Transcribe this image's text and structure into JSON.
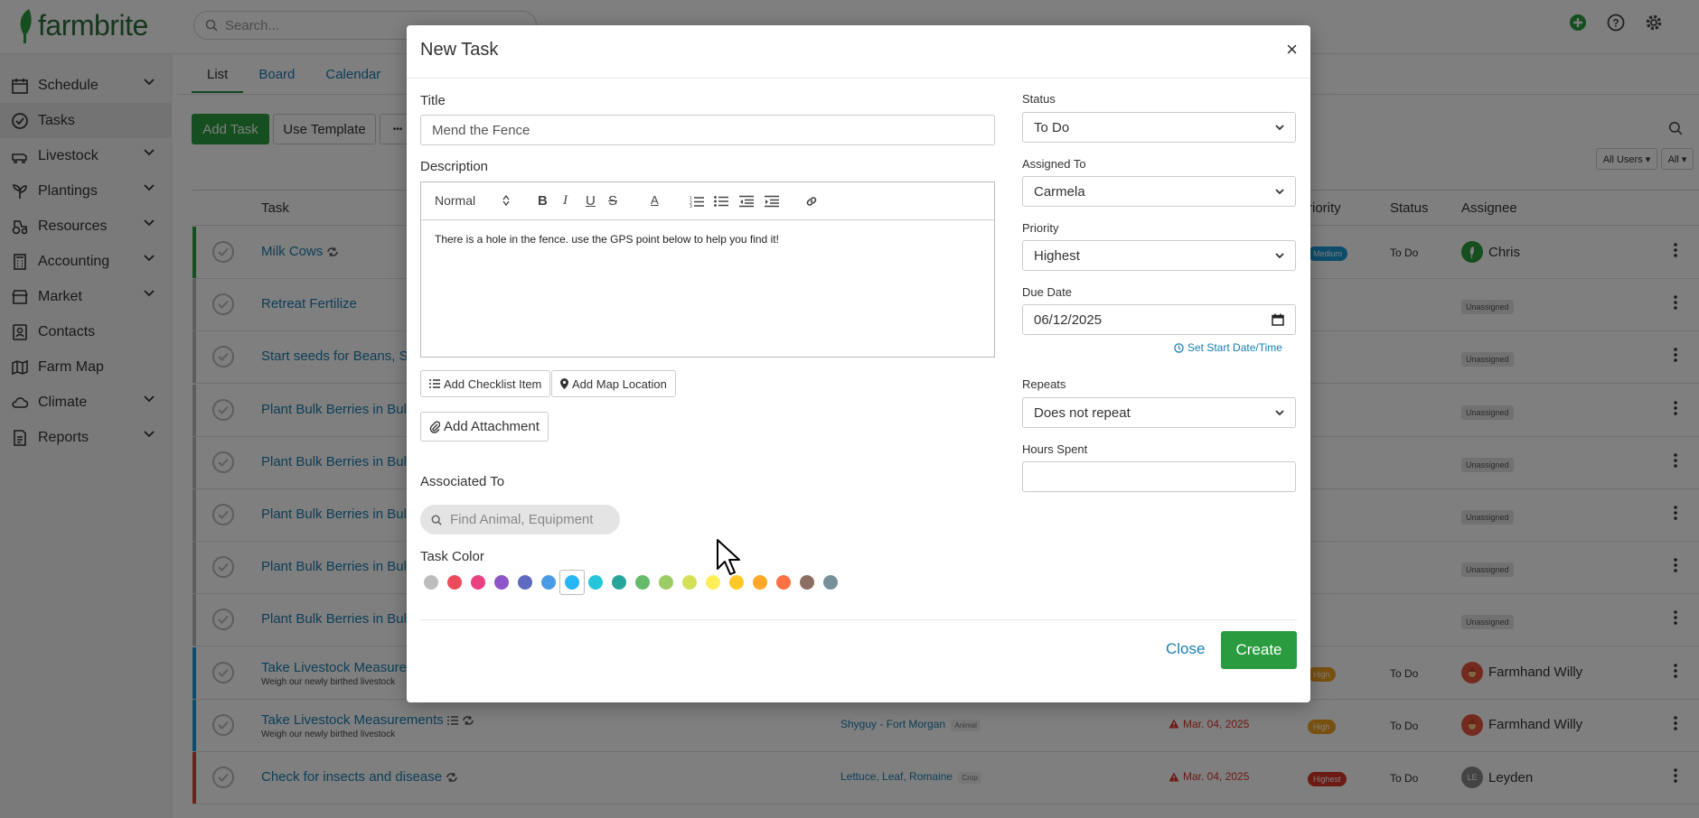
{
  "brand": {
    "name": "farmbrite",
    "green": "#2a9c3f"
  },
  "top": {
    "search_placeholder": "Search..."
  },
  "sidebar": {
    "items": [
      {
        "label": "Schedule",
        "icon": "calendar-icon",
        "chevron": true
      },
      {
        "label": "Tasks",
        "icon": "check-circle-icon",
        "chevron": false
      },
      {
        "label": "Livestock",
        "icon": "cow-icon",
        "chevron": true
      },
      {
        "label": "Plantings",
        "icon": "seedling-icon",
        "chevron": true
      },
      {
        "label": "Resources",
        "icon": "tractor-icon",
        "chevron": true
      },
      {
        "label": "Accounting",
        "icon": "calculator-icon",
        "chevron": true
      },
      {
        "label": "Market",
        "icon": "store-icon",
        "chevron": true
      },
      {
        "label": "Contacts",
        "icon": "contacts-icon",
        "chevron": false
      },
      {
        "label": "Farm Map",
        "icon": "map-icon",
        "chevron": false
      },
      {
        "label": "Climate",
        "icon": "cloud-icon",
        "chevron": true
      },
      {
        "label": "Reports",
        "icon": "report-icon",
        "chevron": true
      }
    ]
  },
  "main": {
    "tabs": [
      "List",
      "Board",
      "Calendar"
    ],
    "add_task": "Add Task",
    "use_template": "Use Template",
    "more": "•••",
    "filter_users": "All Users ▾",
    "filter_all": "All ▾",
    "columns": {
      "task": "Task",
      "priority": "riority",
      "status": "Status",
      "assignee": "Assignee"
    },
    "rows": [
      {
        "name": "Milk Cows",
        "repeat": true,
        "stripe": "#2a9c3f",
        "priority": "Medium",
        "priority_color": "#1a9ad6",
        "status": "To Do",
        "assignee": "Chris",
        "avatar": "farm",
        "sub": "",
        "assoc": "",
        "date": ""
      },
      {
        "name": "Retreat Fertilize",
        "repeat": false,
        "stripe": "#bbbbbb",
        "priority": "",
        "status": "",
        "assignee": "Unassigned",
        "sub": "",
        "assoc": "",
        "date": ""
      },
      {
        "name": "Start seeds for Beans, Su",
        "repeat": false,
        "stripe": "#bbbbbb",
        "priority": "",
        "status": "",
        "assignee": "Unassigned",
        "sub": "",
        "assoc": "",
        "date": ""
      },
      {
        "name": "Plant Bulk Berries in Bulk",
        "repeat": false,
        "stripe": "#bbbbbb",
        "priority": "",
        "status": "",
        "assignee": "Unassigned",
        "sub": "",
        "assoc": "",
        "date": ""
      },
      {
        "name": "Plant Bulk Berries in Bulk",
        "repeat": false,
        "stripe": "#bbbbbb",
        "priority": "",
        "status": "",
        "assignee": "Unassigned",
        "sub": "",
        "assoc": "",
        "date": ""
      },
      {
        "name": "Plant Bulk Berries in Bulk",
        "repeat": false,
        "stripe": "#bbbbbb",
        "priority": "",
        "status": "",
        "assignee": "Unassigned",
        "sub": "",
        "assoc": "",
        "date": ""
      },
      {
        "name": "Plant Bulk Berries in Bulk",
        "repeat": false,
        "stripe": "#bbbbbb",
        "priority": "",
        "status": "",
        "assignee": "Unassigned",
        "sub": "",
        "assoc": "",
        "date": ""
      },
      {
        "name": "Plant Bulk Berries in Bulk",
        "repeat": false,
        "stripe": "#bbbbbb",
        "priority": "",
        "status": "",
        "assignee": "Unassigned",
        "sub": "",
        "assoc": "",
        "date": ""
      },
      {
        "name": "Take Livestock Measuren",
        "repeat": false,
        "stripe": "#1a9ad6",
        "priority": "High",
        "priority_color": "#f0a020",
        "status": "To Do",
        "assignee": "Farmhand Willy",
        "avatar": "willy",
        "sub": "Weigh our newly birthed livestock",
        "assoc": "",
        "date": ""
      },
      {
        "name": "Take Livestock Measurements",
        "repeat": true,
        "list": true,
        "stripe": "#1a9ad6",
        "priority": "High",
        "priority_color": "#f0a020",
        "status": "To Do",
        "assignee": "Farmhand Willy",
        "avatar": "willy",
        "sub": "Weigh our newly birthed livestock",
        "assoc": "Shyguy - Fort Morgan",
        "assoc_tag": "Animal",
        "date": "Mar. 04, 2025"
      },
      {
        "name": "Check for insects and disease",
        "repeat": true,
        "stripe": "#e03c3c",
        "priority": "Highest",
        "priority_color": "#d9342b",
        "status": "To Do",
        "assignee": "Leyden",
        "avatar": "LE",
        "sub": "",
        "assoc": "Lettuce, Leaf, Romaine",
        "assoc_tag": "Crop",
        "date": "Mar. 04, 2025"
      }
    ]
  },
  "modal": {
    "title": "New Task",
    "close_x": "×",
    "title_label": "Title",
    "title_value": "Mend the Fence",
    "description_label": "Description",
    "editor_format": "Normal",
    "description_text": "There is a hole in the fence. use the GPS point below to help you find it!",
    "add_checklist": "Add Checklist Item",
    "add_map_location": "Add Map Location",
    "add_attachment": "Add Attachment",
    "associated_label": "Associated To",
    "associated_placeholder": "Find Animal, Equipment",
    "task_color_label": "Task Color",
    "colors": [
      "#bdbdbd",
      "#ec4b5e",
      "#e94182",
      "#8e54c9",
      "#5c6bc0",
      "#4a9be6",
      "#29b6f6",
      "#26c6da",
      "#26a69a",
      "#66bb6a",
      "#9ccc65",
      "#d4e157",
      "#ffee58",
      "#ffca28",
      "#ffa726",
      "#ff7043",
      "#8d6e63",
      "#78909c"
    ],
    "selected_color": 6,
    "status_label": "Status",
    "status_value": "To Do",
    "assigned_label": "Assigned To",
    "assigned_value": "Carmela",
    "priority_label": "Priority",
    "priority_value": "Highest",
    "due_label": "Due Date",
    "due_value": "06/12/2025",
    "set_start": "Set Start Date/Time",
    "repeats_label": "Repeats",
    "repeats_value": "Does not repeat",
    "hours_label": "Hours Spent",
    "hours_value": "",
    "close_btn": "Close",
    "create_btn": "Create"
  }
}
